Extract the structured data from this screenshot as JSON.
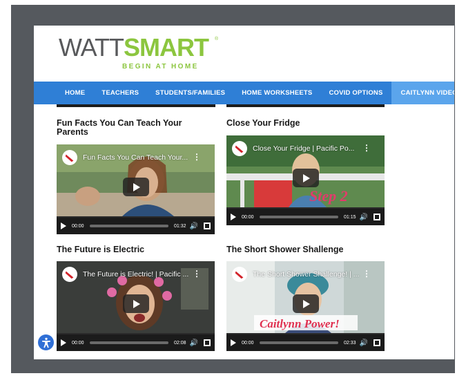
{
  "logo": {
    "watt": "WATT",
    "smart": "SMART",
    "reg": "®",
    "tagline": "BEGIN AT HOME"
  },
  "nav": {
    "items": [
      {
        "label": "HOME"
      },
      {
        "label": "TEACHERS"
      },
      {
        "label": "STUDENTS/FAMILIES"
      },
      {
        "label": "HOME WORKSHEETS"
      },
      {
        "label": "COVID OPTIONS"
      },
      {
        "label": "CAITLYNN VIDEOS"
      }
    ],
    "active_index": 5,
    "color": "#2f7fd6",
    "active_color": "#5ba5ec"
  },
  "videos": [
    {
      "heading": "Fun Facts You Can Teach Your Parents",
      "player_title": "Fun Facts You Can Teach Your...",
      "start_time": "00:00",
      "duration": "01:32"
    },
    {
      "heading": "Close Your Fridge",
      "player_title": "Close Your Fridge | Pacific Po...",
      "start_time": "00:00",
      "duration": "01:15",
      "overlay_text": "Step 2"
    },
    {
      "heading": "The Future is Electric",
      "player_title": "The Future is Electric! | Pacific ...",
      "start_time": "00:00",
      "duration": "02:08"
    },
    {
      "heading": "The Short Shower Shallenge",
      "player_title": "The Short Shower Shallenge! | ...",
      "start_time": "00:00",
      "duration": "02:33",
      "overlay_text": "Caitlynn Power!"
    }
  ],
  "icons": {
    "kebab": "⋮",
    "volume": "🔊",
    "accessibility": "accessibility-icon"
  }
}
